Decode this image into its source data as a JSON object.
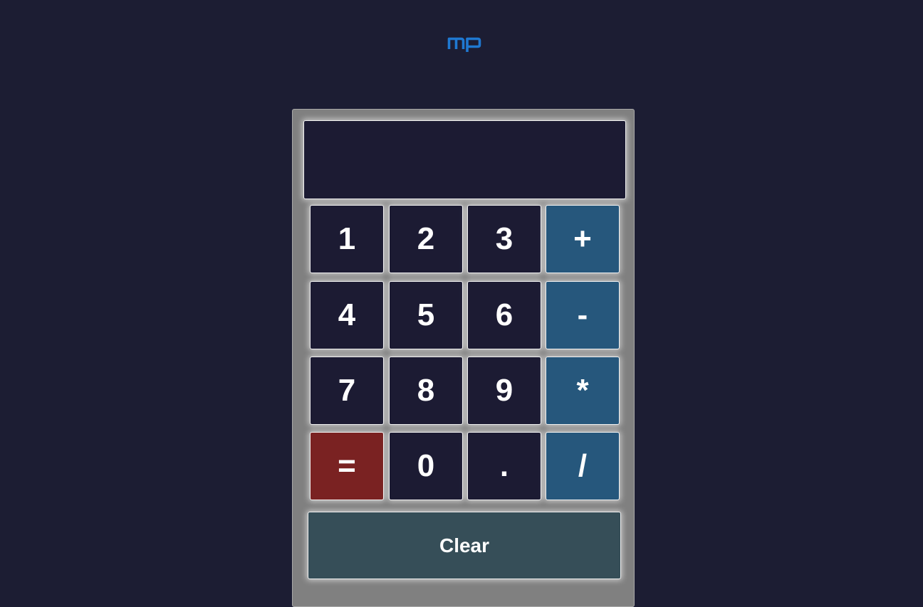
{
  "logo": {
    "text": "mp",
    "color": "#1f78d1",
    "icon": "mp-logo-icon"
  },
  "display": {
    "value": ""
  },
  "keys": {
    "k1": "1",
    "k2": "2",
    "k3": "3",
    "plus": "+",
    "k4": "4",
    "k5": "5",
    "k6": "6",
    "minus": "-",
    "k7": "7",
    "k8": "8",
    "k9": "9",
    "multiply": "*",
    "equals": "=",
    "k0": "0",
    "dot": ".",
    "divide": "/"
  },
  "clear_label": "Clear",
  "colors": {
    "background": "#1c1d33",
    "panel": "#808080",
    "digit_key": "#1c1b33",
    "operator_key": "#26577c",
    "equals_key": "#7a2222",
    "clear_key": "#364e58"
  }
}
